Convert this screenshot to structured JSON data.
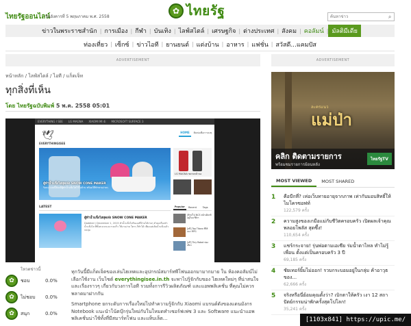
{
  "header": {
    "logo_glyph": "✿",
    "logo_text": "ไทยรัฐ",
    "site_name": "ไทยรัฐออนไลน์",
    "date": "วันอังคารที่ 5 พฤษภาคม พ.ศ. 2558",
    "search_placeholder": "ค้นหาข่าว",
    "search_glyph": "⌕"
  },
  "nav1": [
    {
      "label": "ข่าวในพระราชสำนัก",
      "style": "normal"
    },
    {
      "label": "การเมือง",
      "style": "normal"
    },
    {
      "label": "กีฬา",
      "style": "normal"
    },
    {
      "label": "บันเทิง",
      "style": "normal"
    },
    {
      "label": "ไลฟ์สไตล์",
      "style": "normal"
    },
    {
      "label": "เศรษฐกิจ",
      "style": "normal"
    },
    {
      "label": "ต่างประเทศ",
      "style": "normal"
    },
    {
      "label": "สังคม",
      "style": "normal"
    },
    {
      "label": "คอลัมน์",
      "style": "green"
    },
    {
      "label": "มัลติมีเดีย",
      "style": "active"
    }
  ],
  "nav2": [
    "ท่องเที่ยว",
    "เซ็กซ์",
    "ข่าวไอที",
    "ยานยนต์",
    "แต่งบ้าน",
    "อาหาร",
    "แฟชั่น",
    "สวัสดี...แคมปัส"
  ],
  "ads": {
    "label": "ADVERTISEMENT"
  },
  "breadcrumb": {
    "home": "หน้าหลัก",
    "life": "ไลฟ์สไตล์",
    "it": "ไอที",
    "gadget": "แก็ดเจ็ท",
    "sep": "/"
  },
  "article": {
    "title": "ทุกสิ่งที่เห็น",
    "source": "โดย ไทยรัฐฉบับพิมพ์",
    "date": "5 พ.ค. 2558 05:01",
    "p1_a": "ทุกวันนี้มีแก็ดเจ็ตของเล่นไฮเทคและอุปกรณ์สมาร์ทพีโฟนออกมามากมาย ใน ห้องคอลัมน์ไม่เลือกใช้งาน เว็บไซต์ ",
    "p1_link": "everythingisee.in.th",
    "p1_b": " จะพาไปรู้จักกับของ ไฮเทคใหม่ๆ ที่น่าสนใจ และเรื่องราวๆ เกี่ยวกับวงการไอที รวมทั้งการรีวิวผลิตภัณฑ์ และแอพพลิเคชั่น ที่คุณไม่ควรพลาดมาฝากกัน",
    "p2": "Smartphone ยกระดับการเรื่องใหม่ไปทำความรู้จักกับ Xiaomi แบรนด์ดังของแดนมังกร Notebook แนะนำโน้ตบุ๊กรุ่นใหม่กับในโหมดทำเซอร์ฟเฟซ 3 และ Software แนะนำแอพพลิเคชั่นน่าใช้ทั้งที่มีสมาร์ทโฟน และแท็บเล็ต..."
  },
  "inner_site": {
    "topbar": [
      "EVERYTHING I SEE",
      "LG MAGNA",
      "XIAOMI MI 4i",
      "MICROSOFT SURFACE 3"
    ],
    "logo_glyph": "🕊",
    "logo_text": "EVERYTHINGISEE",
    "tab_home": "HOME",
    "tab_other": "ติดต่อเพื่อการลงทุ",
    "feature_caption": "ตู้ทำน้ำแข็งไสสุดเจ๋ง SNOW CONE MAKER",
    "feature_sub": "ร้อนๆ แบบนี้ต้องมีตู้ทำน้ำแข็งไสไว้ในบ้าน พร้อมวิธีทำทานง่ายๆ",
    "side_label": "LG MAGNA ขยายหน้าจอ",
    "latest": "LATEST",
    "item_title": "ตู้ทำน้ำแข็งไสสุดเจ๋ง SNOW CONE MAKER",
    "item_desc": "Daddied | December 1, 2015 ทำน้ำแข็งไสกินเองที่บ้านได้ง่ายๆ ด้วยเครื่องทำน้ำแข็งไส ที่ทั้งสะดวกและรวดเร็ว ใช้งานง่าย ใครๆ ก็ทำได้ เพียงแค่เติมน้ำแข็งแล้วกดปุ่ม",
    "tabs2": [
      "Popular",
      "Recent",
      "Tags"
    ],
    "pop": [
      "[ซ้ายวิ้ว] NCS หน้าเดียวทีอยู่ในนาฬิกา",
      "[ฟรี] Top Titans ซีรี่ส์แนว RPG",
      "[ฟรี] Tiny Robot ท่องเที่ยว"
    ]
  },
  "poll": {
    "title": "โหวตข่าวนี้",
    "rows": [
      {
        "label": "ชอบ",
        "value": "0.0%"
      },
      {
        "label": "ไม่ชอบ",
        "value": "0.0%"
      },
      {
        "label": "สนุก",
        "value": "0.0%"
      }
    ]
  },
  "right_ad": {
    "title": "แม่ป่า",
    "subtitle": "ละครแนว",
    "line1": "คลิก ติดตามรายการ",
    "line2": "พร้อมชมรายการย้อนหลัง",
    "badge": "ไทยรัฐTV"
  },
  "most": {
    "tab_viewed": "MOST VIEWED",
    "tab_shared": "MOST SHARED",
    "items": [
      {
        "num": "1",
        "text": "คือบีกที่? เห่อเว็บทายอายุจากภาพ เท่ากับมอบสิทธิ์ให้ไมโครซอฟท์",
        "views": "122,579 ครั้ง"
      },
      {
        "num": "2",
        "text": "ความสูงของเกมือแม่กับชีวิตครอบครัว เปิดผลเจ้าคุณพลอยโพลัส สุดซึ้ง!",
        "views": "110,654 ครั้ง"
      },
      {
        "num": "3",
        "text": "แชร์กระจาย! รุ่นพ่อตามเอเซีย ร่มน้ำตาไหล ทำไม่รู้เพื่อน ตั้งแต่เป็นครอบครัว 3 ปี",
        "views": "69,185 ครั้ง"
      },
      {
        "num": "4",
        "text": "ชัยเทอร์ยิ้มไม่ออก! รวบกระบอมอยู่ในกลุ่ม ค้าอาวุธของ...",
        "views": "62,666 ครั้ง"
      },
      {
        "num": "5",
        "text": "จริงหรือนี่ย์อมคุณตั้งว่า? เบิกตาให้ครัว เงา 12 สถาปัตย์กรรมน่าพักครั้งสุดโปโลก!",
        "views": "35,241 ครั้ง"
      }
    ]
  },
  "watermark": "[1103x841] https://upic.me/"
}
